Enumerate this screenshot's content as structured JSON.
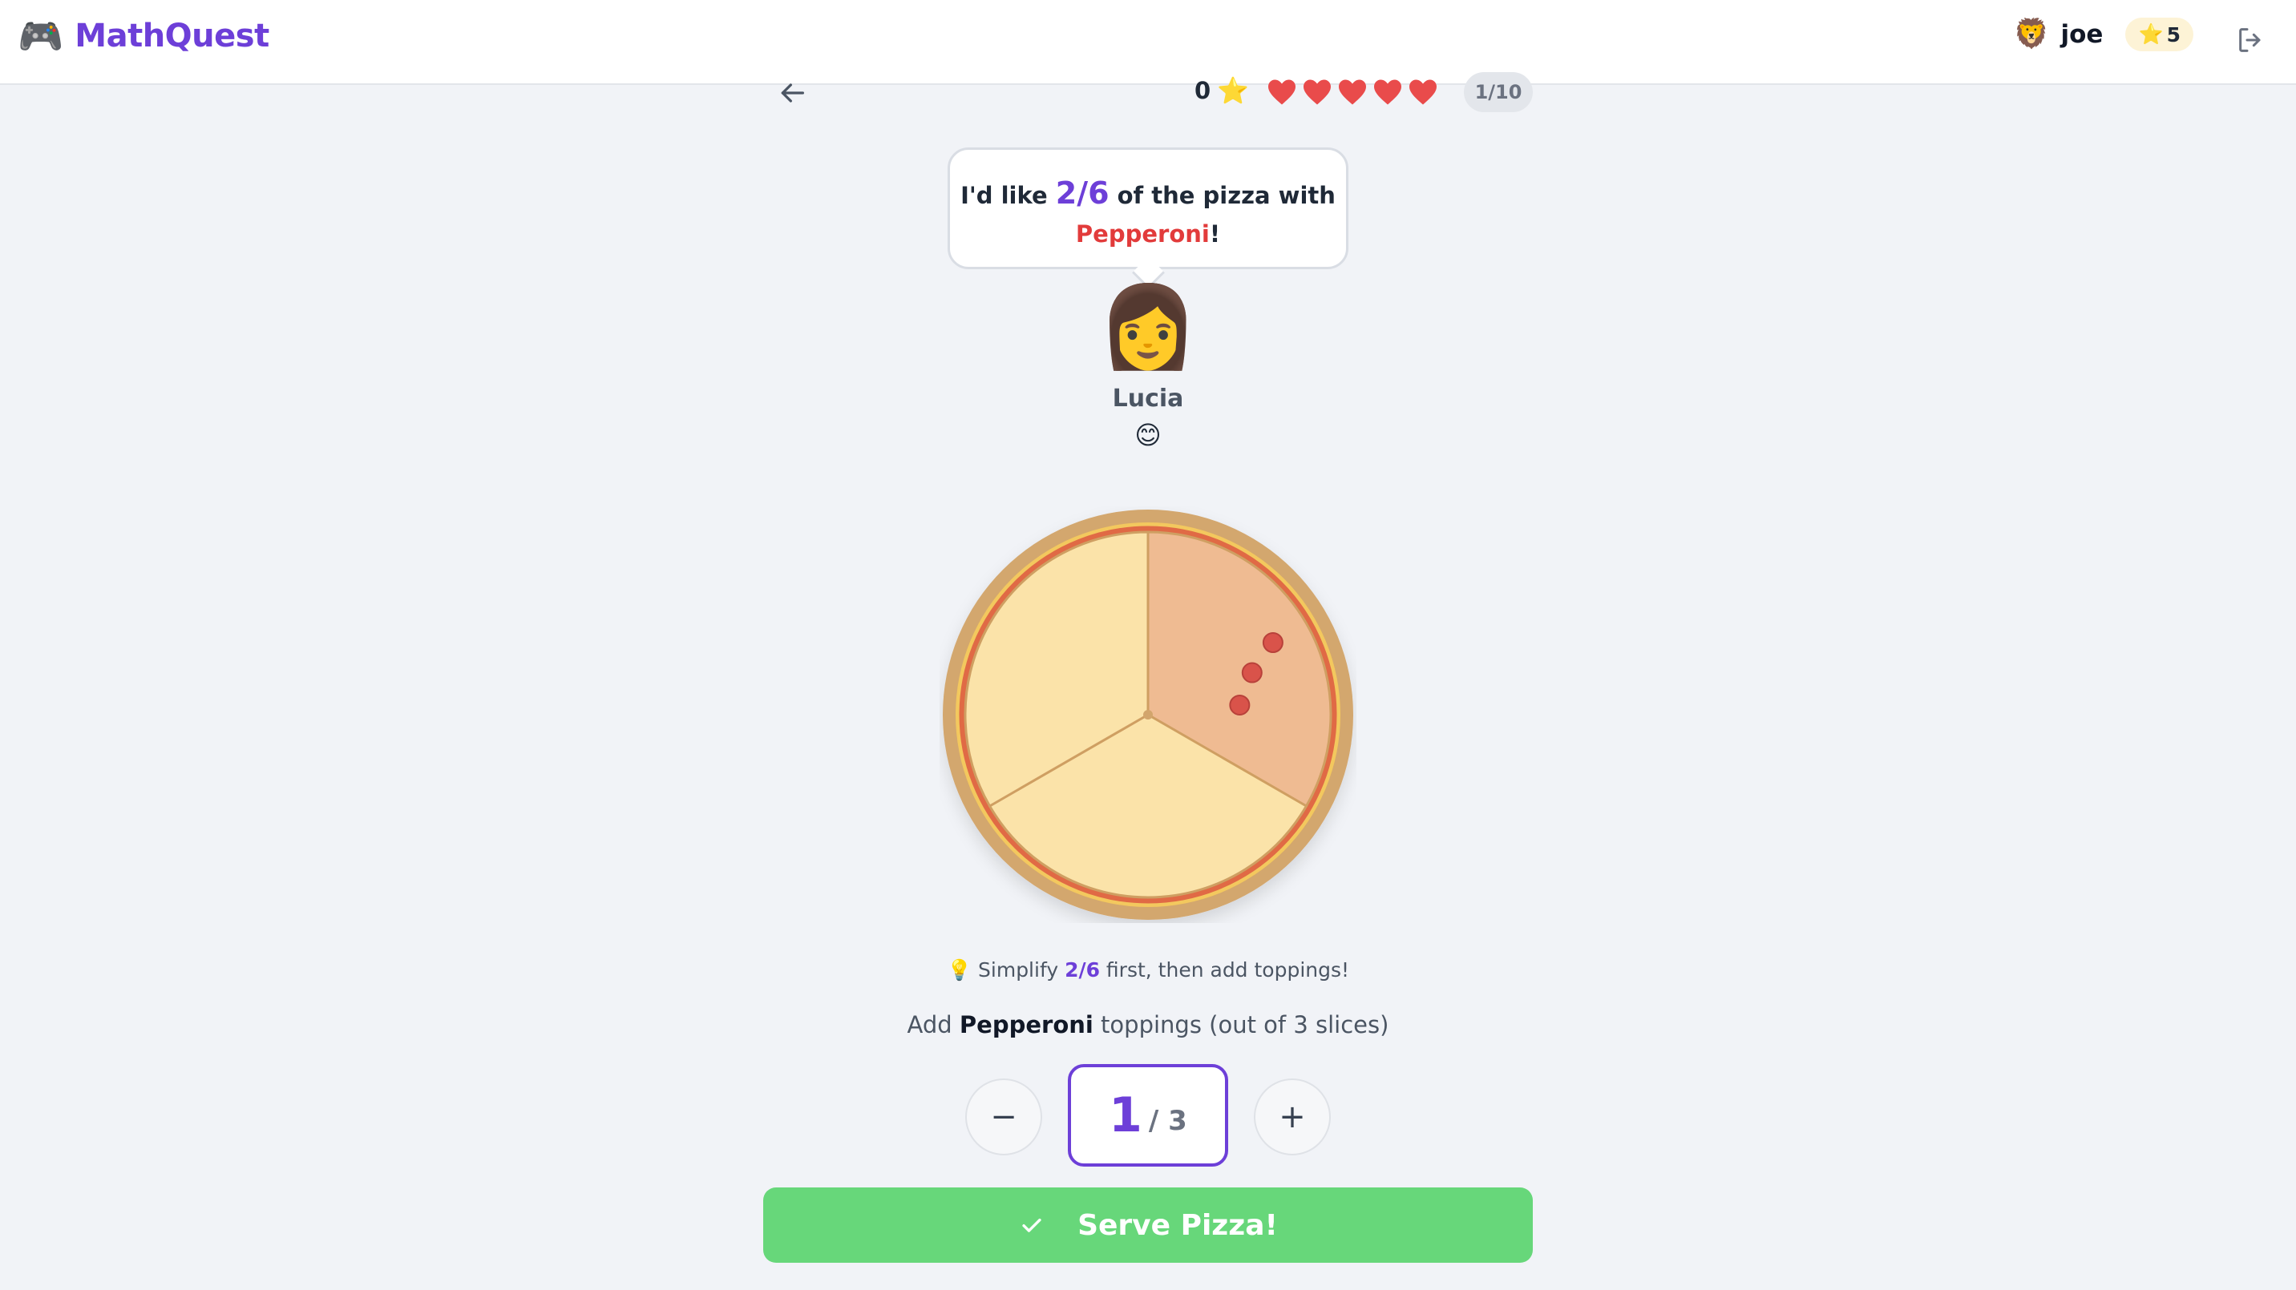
{
  "app": {
    "logo_icon": "🎮",
    "name": "MathQuest"
  },
  "user": {
    "avatar": "🦁",
    "name": "joe",
    "star_icon": "⭐",
    "stars": "5"
  },
  "game": {
    "score": "0",
    "score_icon": "⭐",
    "lives": 5,
    "progress": "1/10"
  },
  "customer": {
    "request_prefix": "I'd like ",
    "fraction": "2/6",
    "request_middle": " of the pizza with ",
    "topping": "Pepperoni",
    "request_suffix": "!",
    "avatar": "👩",
    "name": "Lucia",
    "mood": "😊"
  },
  "pizza": {
    "slices": 3,
    "topped_slices": 1,
    "topping_color": "#d9534a"
  },
  "hint": {
    "icon": "💡",
    "prefix": " Simplify ",
    "fraction": "2/6",
    "suffix": " first, then add toppings!"
  },
  "instruction": {
    "prefix": "Add ",
    "topping": "Pepperoni",
    "suffix": " toppings (out of 3 slices)"
  },
  "counter": {
    "minus": "−",
    "plus": "+",
    "numerator": "1",
    "denominator": "/ 3"
  },
  "serve": {
    "label": "Serve Pizza!"
  },
  "colors": {
    "brand": "#6d3fd8",
    "heart": "#e94b4b",
    "serve_button": "#67d77a",
    "topping_text": "#e23b3b"
  }
}
